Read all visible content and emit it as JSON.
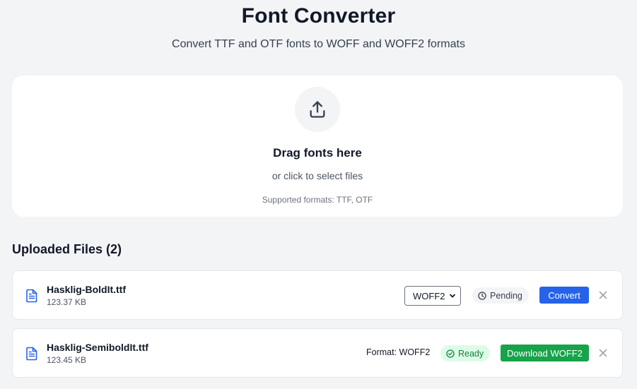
{
  "header": {
    "title": "Font Converter",
    "subtitle": "Convert TTF and OTF fonts to WOFF and WOFF2 formats"
  },
  "dropzone": {
    "icon": "upload-icon",
    "title": "Drag fonts here",
    "subtitle": "or click to select files",
    "formats": "Supported formats: TTF, OTF"
  },
  "files_section": {
    "title": "Uploaded Files (2)"
  },
  "files": [
    {
      "name": "Hasklig-BoldIt.ttf",
      "size": "123.37 KB",
      "format_select": "WOFF2",
      "status": "Pending",
      "action": "Convert"
    },
    {
      "name": "Hasklig-SemiboldIt.ttf",
      "size": "123.45 KB",
      "format_label": "Format: WOFF2",
      "status": "Ready",
      "action": "Download WOFF2"
    }
  ],
  "colors": {
    "primary": "#2563eb",
    "success": "#16a34a",
    "background": "#f3f4f6"
  }
}
